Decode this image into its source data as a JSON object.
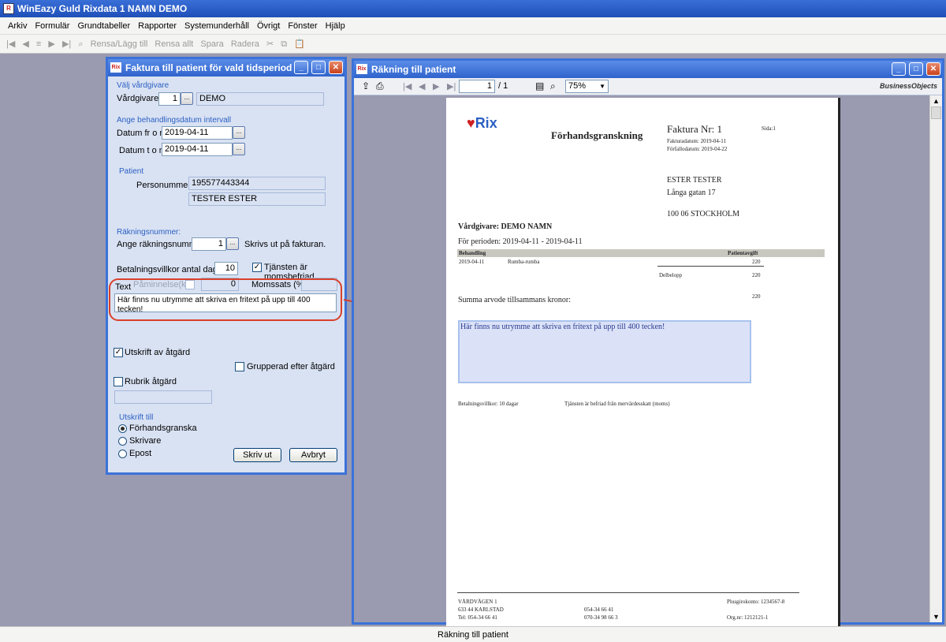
{
  "app": {
    "title": "WinEazy Guld Rixdata 1 NAMN DEMO",
    "icon": "rix-app-icon"
  },
  "menu": [
    "Arkiv",
    "Formulär",
    "Grundtabeller",
    "Rapporter",
    "Systemunderhåll",
    "Övrigt",
    "Fönster",
    "Hjälp"
  ],
  "toolbar": {
    "rensa_lagg": "Rensa/Lägg till",
    "rensa_allt": "Rensa allt",
    "spara": "Spara",
    "radera": "Radera"
  },
  "dialog": {
    "title": "Faktura till patient för vald tidsperiod",
    "valj_vardgivare": "Välj vårdgivare",
    "vardgivare_label": "Vårdgivare:",
    "vardgivare_value": "1",
    "vardgivare_name": "DEMO",
    "datum_group": "Ange behandlingsdatum intervall",
    "datum_from_label": "Datum fr o m:",
    "datum_from_value": "2019-04-11",
    "datum_tom_label": "Datum t o m:",
    "datum_tom_value": "2019-04-11",
    "patient_group": "Patient",
    "personnummer_label": "Personummer:",
    "personnummer_value": "195577443344",
    "patient_name": "TESTER ESTER",
    "rakning_group": "Räkningsnummer:",
    "rakning_label": "Ange räkningsnummer:",
    "rakning_value": "1",
    "skrivs_ut": "Skrivs ut på fakturan.",
    "betalning_label": "Betalningsvillkor antal dagar:",
    "betalning_value": "10",
    "momsbefriad_label": "Tjänsten är momsbefriad",
    "paminnelse_label": "Påminnelse(kr):",
    "paminnelse_value": "0",
    "momssats_label": "Momssats (%):",
    "text_label": "Text",
    "text_value": "Här finns nu utrymme att skriva en fritext på upp till 400 tecken!",
    "utskrift_atgard": "Utskrift av åtgärd",
    "grupperad": "Grupperad efter åtgärd",
    "rubrik": "Rubrik åtgärd",
    "utskrift_till": "Utskrift till",
    "radio_forhand": "Förhandsgranska",
    "radio_skrivare": "Skrivare",
    "radio_epost": "Epost",
    "skriv_ut_btn": "Skriv ut",
    "avbryt_btn": "Avbryt"
  },
  "report": {
    "title": "Räkning till patient",
    "page_value": "1",
    "page_total": "/ 1",
    "zoom": "75%",
    "brand": "BusinessObjects",
    "doc": {
      "logo": "Rix",
      "heading": "Förhandsgranskning",
      "faktura_nr": "Faktura Nr:  1",
      "sida": "Sida:1",
      "fakturadatum": "Fakturadatum: 2019-04-11",
      "forfallodatum": "Förfallodatum: 2019-04-22",
      "recipient_name": "ESTER TESTER",
      "recipient_street": "Långa gatan 17",
      "recipient_city": "100 06 STOCKHOLM",
      "vardgivare": "Vårdgivare:  DEMO NAMN",
      "period": "För perioden:  2019-04-11 - 2019-04-11",
      "col_behandling": "Behandling",
      "col_patientavgift": "Patientavgift",
      "row_date": "2019-04-11",
      "row_desc": "Rumba-rumba",
      "row_amount": "220",
      "delbelopp": "Delbelopp",
      "delbelopp_amount": "220",
      "summa": "Summa arvode tillsammans kronor:",
      "summa_amount": "220",
      "fritext": "Här finns nu utrymme att skriva en fritext på upp till 400 tecken!",
      "betvillkor": "Betalningsvillkor: 10 dagar",
      "moms_note": "Tjänsten är befriad från mervärdesskatt (moms)",
      "footer_addr1": "VÅRDVÄGEN 1",
      "footer_addr2": "633 44  KARLSTAD",
      "footer_tel": "Tel: 054-34 66 41",
      "footer_ph1": "054-34 66 41",
      "footer_ph2": "070-34 98 66 3",
      "footer_plusgiro": "Plusgirokonto: 1234567-8",
      "footer_orgnr": "Org.nr:  1212121-1"
    }
  },
  "status": "Räkning till patient",
  "colors": {
    "titlebar": "#2f64cc",
    "dialog_bg": "#d9e2f3",
    "highlight": "#d9402a",
    "fritext_box": "#dbe2f8"
  }
}
